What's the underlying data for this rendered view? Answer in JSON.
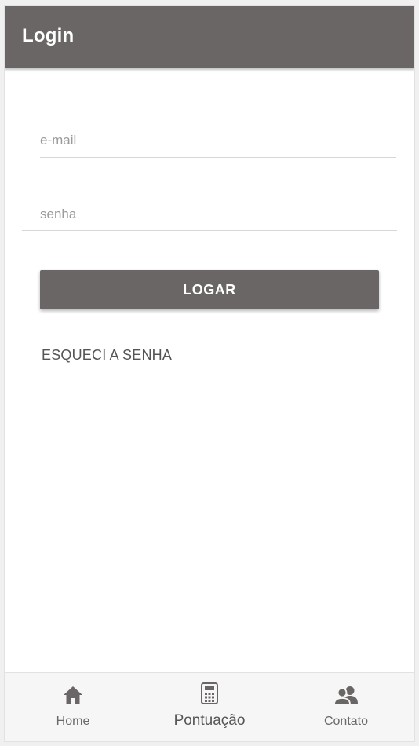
{
  "appbar": {
    "title": "Login"
  },
  "form": {
    "email_placeholder": "e-mail",
    "password_placeholder": "senha",
    "login_label": "LOGAR",
    "forgot_label": "ESQUECI A SENHA"
  },
  "bottom_nav": {
    "items": [
      {
        "label": "Home",
        "icon": "home-icon"
      },
      {
        "label": "Pontuação",
        "icon": "calculator-icon",
        "active": true
      },
      {
        "label": "Contato",
        "icon": "contacts-icon"
      }
    ]
  },
  "colors": {
    "primary": "#6b6666",
    "background": "#ffffff",
    "nav_background": "#f6f6f6",
    "link_text": "#555555"
  }
}
